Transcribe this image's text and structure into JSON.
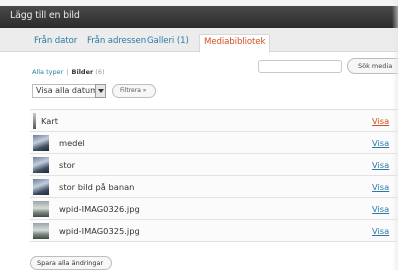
{
  "dialog": {
    "title": "Lägg till en bild"
  },
  "tabs": [
    {
      "label": "Från dator",
      "active": false
    },
    {
      "label": "Från adressen",
      "active": false
    },
    {
      "label": "Galleri (1)",
      "active": false
    },
    {
      "label": "Mediabibliotek",
      "active": true
    }
  ],
  "filters": {
    "all_types": "Alla typer",
    "separator": "|",
    "images": "Bilder",
    "images_count": "(6)",
    "date_select": "Visa alla datum",
    "filter_button": "Filtrera »",
    "search_button": "Sök media"
  },
  "media_items": [
    {
      "name": "Kart",
      "action": "Visa",
      "thumb": "thin-image-icon",
      "action_color": "#d54e21"
    },
    {
      "name": "medel",
      "action": "Visa",
      "thumb": "photo-thumbnail",
      "action_color": "#2a7aa8"
    },
    {
      "name": "stor",
      "action": "Visa",
      "thumb": "photo-thumbnail",
      "action_color": "#2a7aa8"
    },
    {
      "name": "stor bild på banan",
      "action": "Visa",
      "thumb": "photo-thumbnail",
      "action_color": "#2a7aa8"
    },
    {
      "name": "wpid-IMAG0326.jpg",
      "action": "Visa",
      "thumb": "photo-thumbnail",
      "action_color": "#2a7aa8"
    },
    {
      "name": "wpid-IMAG0325.jpg",
      "action": "Visa",
      "thumb": "photo-thumbnail",
      "action_color": "#2a7aa8"
    }
  ],
  "footer": {
    "save_all": "Spara alla ändringar"
  },
  "colors": {
    "link": "#2a7aa8",
    "active_tab": "#d54e21",
    "titlebar": "#333333"
  }
}
